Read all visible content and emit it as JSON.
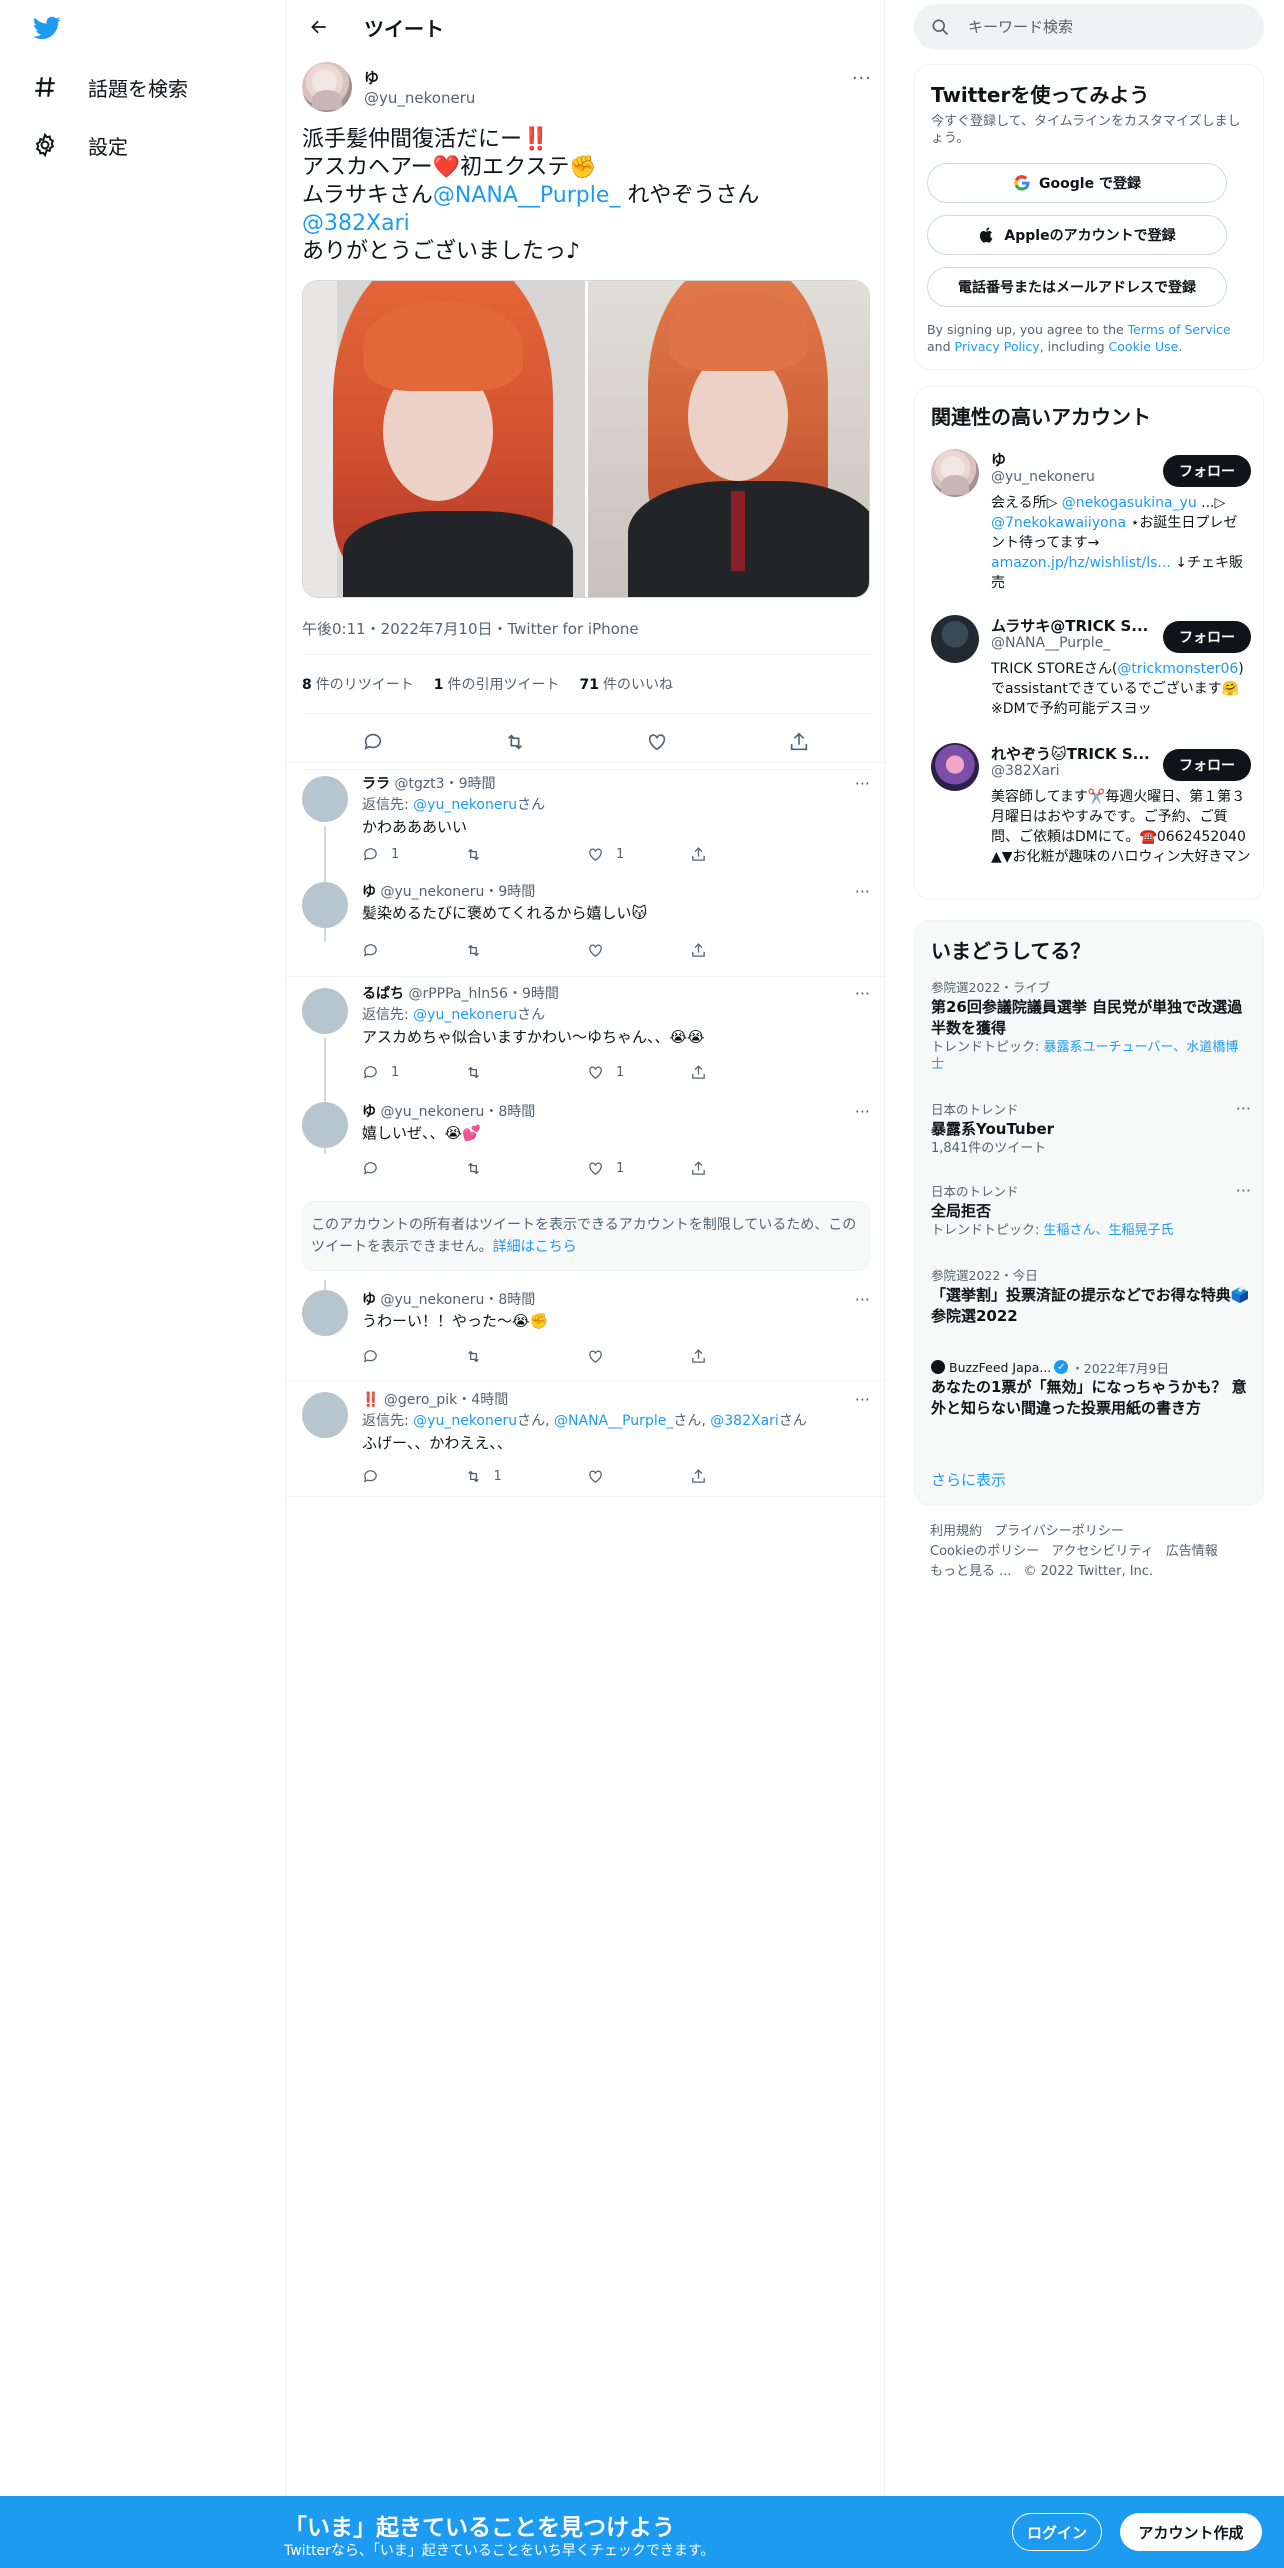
{
  "nav": {
    "explore_label": "話題を検索",
    "settings_label": "設定"
  },
  "header": {
    "title": "ツイート"
  },
  "main_tweet": {
    "name": "ゆ",
    "handle": "@yu_nekoneru",
    "line1": "派手髪仲間復活だにー‼️",
    "line2": "アスカヘアー❤️初エクステ✊",
    "line3_a": "ムラサキさん",
    "line3_mention": "@NANA__Purple_",
    "line3_b": " れやぞうさん",
    "line4_mention": "@382Xari",
    "line5": "ありがとうございましたっ♪",
    "meta": "午後0:11・2022年7月10日・Twitter for iPhone",
    "retweets": "8",
    "retweets_label": "件のリツイート",
    "quotes": "1",
    "quotes_label": "件の引用ツイート",
    "likes": "71",
    "likes_label": "件のいいね"
  },
  "replies": [
    {
      "name": "ララ",
      "handle": "@tgzt3",
      "time": "9時間",
      "to_prefix": "返信先: ",
      "to_mention": "@yu_nekoneru",
      "to_suffix": "さん",
      "text": "かわあああいい",
      "reply_count": "1",
      "retweet_count": "",
      "like_count": "1"
    },
    {
      "name": "ゆ",
      "handle": "@yu_nekoneru",
      "time": "9時間",
      "text": "髪染めるたびに褒めてくれるから嬉しい😽",
      "reply_count": "",
      "retweet_count": "",
      "like_count": ""
    },
    {
      "name": "るぱち",
      "handle": "@rPPPa_hln56",
      "time": "9時間",
      "to_prefix": "返信先: ",
      "to_mention": "@yu_nekoneru",
      "to_suffix": "さん",
      "text": "アスカめちゃ似合いますかわい〜ゆちゃん、、😭😭",
      "reply_count": "1",
      "retweet_count": "",
      "like_count": "1"
    },
    {
      "name": "ゆ",
      "handle": "@yu_nekoneru",
      "time": "8時間",
      "text": "嬉しいぜ、、😭💕",
      "reply_count": "",
      "retweet_count": "",
      "like_count": "1"
    },
    {
      "name": "ゆ",
      "handle": "@yu_nekoneru",
      "time": "8時間",
      "text": "うわーい！！やった〜😭✊",
      "reply_count": "",
      "retweet_count": "",
      "like_count": ""
    },
    {
      "name": "‼️",
      "handle": "@gero_pik",
      "time": "4時間",
      "to_prefix": "返信先: ",
      "to_m1": "@yu_nekoneru",
      "to_s1": "さん, ",
      "to_m2": "@NANA__Purple_",
      "to_s2": "さん, ",
      "to_m3": "@382Xari",
      "to_s3": "さん",
      "text": "ふげー、、かわええ、、",
      "reply_count": "",
      "retweet_count": "1",
      "like_count": ""
    }
  ],
  "restricted": {
    "text": "このアカウントの所有者はツイートを表示できるアカウントを制限しているため、このツイートを表示できません。",
    "link": "詳細はこちら"
  },
  "search": {
    "placeholder": "キーワード検索"
  },
  "signup_card": {
    "title": "Twitterを使ってみよう",
    "subtitle": "今すぐ登録して、タイムラインをカスタマイズしましょう。",
    "google": "Google で登録",
    "apple": "Appleのアカウントで登録",
    "phone": "電話番号またはメールアドレスで登録",
    "legal_a": "By signing up, you agree to the ",
    "legal_terms": "Terms of Service",
    "legal_b": " and ",
    "legal_privacy": "Privacy Policy",
    "legal_c": ", including ",
    "legal_cookie": "Cookie Use",
    "legal_d": "."
  },
  "related": {
    "title": "関連性の高いアカウント",
    "follow_label": "フォロー",
    "accounts": [
      {
        "name": "ゆ",
        "handle": "@yu_nekoneru",
        "bio_a": "会える所▷ ",
        "bio_m1": "@nekogasukina_yu",
        "bio_b": " ...▷ ",
        "bio_m2": "@7nekokawaiiyona",
        "bio_c": " ⋆お誕生日プレゼント待ってます→ ",
        "bio_m3": "amazon.jp/hz/wishlist/ls...",
        "bio_d": " ↓チェキ販売"
      },
      {
        "name": "ムラサキ@TRICK S...",
        "handle": "@NANA__Purple_",
        "bio_a": "TRICK STOREさん(",
        "bio_m1": "@trickmonster06",
        "bio_b": ")でassistantできているでございます🤗※DMで予約可能デスヨッ"
      },
      {
        "name": "れやぞう🐱TRICK S...",
        "handle": "@382Xari",
        "bio_a": "美容師してます✂️毎週火曜日、第１第３月曜日はおやすみです。ご予約、ご質問、ご依頼はDMにて。☎️0662452040 ▲▼お化粧が趣味のハロウィン大好きマンです。顔面不安定"
      }
    ]
  },
  "trends": {
    "title": "いまどうしてる？",
    "items": [
      {
        "context": "参院選2022・ライブ",
        "title": "第26回参議院議員選挙 自民党が単独で改選過半数を獲得",
        "sub_prefix": "トレンドトピック: ",
        "sub_link": "暴露系ユーチューバー、水道橋博士"
      },
      {
        "context": "日本のトレンド",
        "title": "暴露系YouTuber",
        "sub": "1,841件のツイート"
      },
      {
        "context": "日本のトレンド",
        "title": "全局拒否",
        "sub_prefix": "トレンドトピック: ",
        "sub_link": "生稲さん、生稲晃子氏"
      },
      {
        "context": "参院選2022・今日",
        "title": "「選挙割」投票済証の提示などでお得な特典🗳️参院選2022"
      },
      {
        "source": "BuzzFeed Japa...",
        "context_date": "・2022年7月9日",
        "title": "あなたの1票が「無効」になっちゃうかも？ 意外と知らない間違った投票用紙の書き方"
      }
    ],
    "show_more": "さらに表示"
  },
  "footer": {
    "terms": "利用規約",
    "privacy": "プライバシーポリシー",
    "cookie": "Cookieのポリシー",
    "accessibility": "アクセシビリティ",
    "ads": "広告情報",
    "more": "もっと見る ...",
    "copyright": "© 2022 Twitter, Inc."
  },
  "bottom_bar": {
    "title": "「いま」起きていることを見つけよう",
    "subtitle": "Twitterなら、「いま」起きていることをいち早くチェックできます。",
    "login": "ログイン",
    "signup": "アカウント作成"
  },
  "colors": {
    "accent": "#1d9bf0",
    "text": "#0f1419",
    "muted": "#536471"
  }
}
